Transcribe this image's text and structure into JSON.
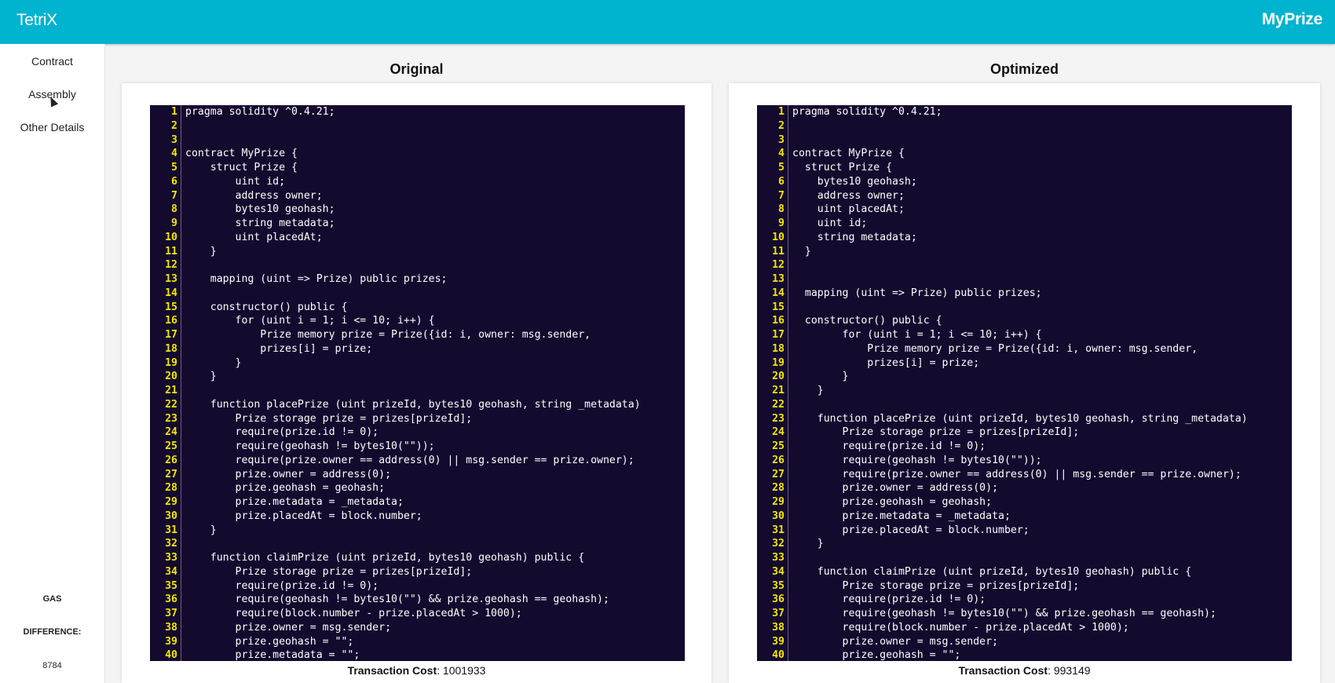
{
  "header": {
    "brand": "TetriX",
    "title": "MyPrize"
  },
  "sidebar": {
    "items": [
      {
        "label": "Contract"
      },
      {
        "label": "Assembly"
      },
      {
        "label": "Other Details"
      }
    ],
    "gas_label_1": "GAS",
    "gas_label_2": "DIFFERENCE:",
    "gas_value": "8784"
  },
  "panels": [
    {
      "title": "Original",
      "cost_label": "Transaction Cost",
      "cost_value": "1001933",
      "lines": [
        "pragma solidity ^0.4.21;",
        "",
        "",
        "contract MyPrize {",
        "    struct Prize {",
        "        uint id;",
        "        address owner;",
        "        bytes10 geohash;",
        "        string metadata;",
        "        uint placedAt;",
        "    }",
        "",
        "    mapping (uint => Prize) public prizes;",
        "",
        "    constructor() public {",
        "        for (uint i = 1; i <= 10; i++) {",
        "            Prize memory prize = Prize({id: i, owner: msg.sender,",
        "            prizes[i] = prize;",
        "        }",
        "    }",
        "",
        "    function placePrize (uint prizeId, bytes10 geohash, string _metadata)",
        "        Prize storage prize = prizes[prizeId];",
        "        require(prize.id != 0);",
        "        require(geohash != bytes10(\"\"));",
        "        require(prize.owner == address(0) || msg.sender == prize.owner);",
        "        prize.owner = address(0);",
        "        prize.geohash = geohash;",
        "        prize.metadata = _metadata;",
        "        prize.placedAt = block.number;",
        "    }",
        "",
        "    function claimPrize (uint prizeId, bytes10 geohash) public {",
        "        Prize storage prize = prizes[prizeId];",
        "        require(prize.id != 0);",
        "        require(geohash != bytes10(\"\") && prize.geohash == geohash);",
        "        require(block.number - prize.placedAt > 1000);",
        "        prize.owner = msg.sender;",
        "        prize.geohash = \"\";",
        "        prize.metadata = \"\";"
      ]
    },
    {
      "title": "Optimized",
      "cost_label": "Transaction Cost",
      "cost_value": "993149",
      "lines": [
        "pragma solidity ^0.4.21;",
        "",
        "",
        "contract MyPrize {",
        "  struct Prize {",
        "    bytes10 geohash;",
        "    address owner;",
        "    uint placedAt;",
        "    uint id;",
        "    string metadata;",
        "  }",
        "",
        "",
        "  mapping (uint => Prize) public prizes;",
        "",
        "  constructor() public {",
        "        for (uint i = 1; i <= 10; i++) {",
        "            Prize memory prize = Prize({id: i, owner: msg.sender,",
        "            prizes[i] = prize;",
        "        }",
        "    }",
        "",
        "    function placePrize (uint prizeId, bytes10 geohash, string _metadata)",
        "        Prize storage prize = prizes[prizeId];",
        "        require(prize.id != 0);",
        "        require(geohash != bytes10(\"\"));",
        "        require(prize.owner == address(0) || msg.sender == prize.owner);",
        "        prize.owner = address(0);",
        "        prize.geohash = geohash;",
        "        prize.metadata = _metadata;",
        "        prize.placedAt = block.number;",
        "    }",
        "",
        "    function claimPrize (uint prizeId, bytes10 geohash) public {",
        "        Prize storage prize = prizes[prizeId];",
        "        require(prize.id != 0);",
        "        require(geohash != bytes10(\"\") && prize.geohash == geohash);",
        "        require(block.number - prize.placedAt > 1000);",
        "        prize.owner = msg.sender;",
        "        prize.geohash = \"\";"
      ]
    }
  ]
}
